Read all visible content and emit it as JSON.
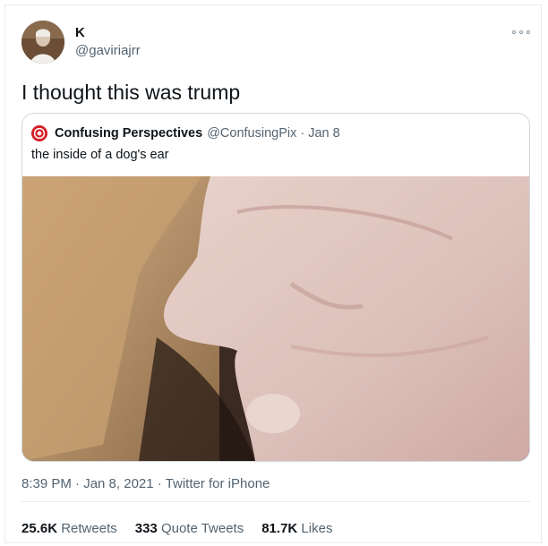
{
  "tweet": {
    "author": {
      "name": "K",
      "handle": "@gaviriajrr"
    },
    "text": "I thought this was trump",
    "timestamp": "8:39 PM · Jan 8, 2021",
    "source": "Twitter for iPhone"
  },
  "quoted_tweet": {
    "author_name": "Confusing Perspectives",
    "handle_date": "@ConfusingPix · Jan 8",
    "text": "the inside of a dog's ear",
    "media_icon": "photo"
  },
  "stats": [
    {
      "value": "25.6K",
      "label": "Retweets"
    },
    {
      "value": "333",
      "label": "Quote Tweets"
    },
    {
      "value": "81.7K",
      "label": "Likes"
    }
  ],
  "colors": {
    "text": "#0f1419",
    "secondary": "#536471",
    "border": "#cfd9de",
    "divider": "#e6ecf0",
    "quote_avatar": "#d6202a"
  },
  "icons": {
    "more": "more-icon"
  }
}
